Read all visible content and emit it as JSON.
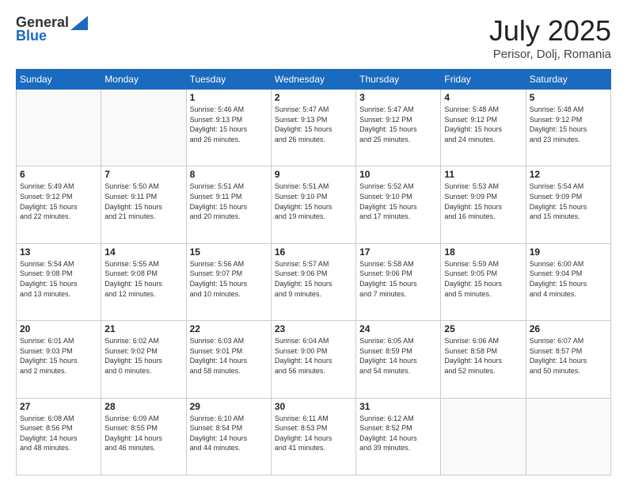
{
  "header": {
    "logo_general": "General",
    "logo_blue": "Blue",
    "month": "July 2025",
    "location": "Perisor, Dolj, Romania"
  },
  "days_of_week": [
    "Sunday",
    "Monday",
    "Tuesday",
    "Wednesday",
    "Thursday",
    "Friday",
    "Saturday"
  ],
  "weeks": [
    [
      {
        "num": "",
        "info": ""
      },
      {
        "num": "",
        "info": ""
      },
      {
        "num": "1",
        "info": "Sunrise: 5:46 AM\nSunset: 9:13 PM\nDaylight: 15 hours\nand 26 minutes."
      },
      {
        "num": "2",
        "info": "Sunrise: 5:47 AM\nSunset: 9:13 PM\nDaylight: 15 hours\nand 26 minutes."
      },
      {
        "num": "3",
        "info": "Sunrise: 5:47 AM\nSunset: 9:12 PM\nDaylight: 15 hours\nand 25 minutes."
      },
      {
        "num": "4",
        "info": "Sunrise: 5:48 AM\nSunset: 9:12 PM\nDaylight: 15 hours\nand 24 minutes."
      },
      {
        "num": "5",
        "info": "Sunrise: 5:48 AM\nSunset: 9:12 PM\nDaylight: 15 hours\nand 23 minutes."
      }
    ],
    [
      {
        "num": "6",
        "info": "Sunrise: 5:49 AM\nSunset: 9:12 PM\nDaylight: 15 hours\nand 22 minutes."
      },
      {
        "num": "7",
        "info": "Sunrise: 5:50 AM\nSunset: 9:11 PM\nDaylight: 15 hours\nand 21 minutes."
      },
      {
        "num": "8",
        "info": "Sunrise: 5:51 AM\nSunset: 9:11 PM\nDaylight: 15 hours\nand 20 minutes."
      },
      {
        "num": "9",
        "info": "Sunrise: 5:51 AM\nSunset: 9:10 PM\nDaylight: 15 hours\nand 19 minutes."
      },
      {
        "num": "10",
        "info": "Sunrise: 5:52 AM\nSunset: 9:10 PM\nDaylight: 15 hours\nand 17 minutes."
      },
      {
        "num": "11",
        "info": "Sunrise: 5:53 AM\nSunset: 9:09 PM\nDaylight: 15 hours\nand 16 minutes."
      },
      {
        "num": "12",
        "info": "Sunrise: 5:54 AM\nSunset: 9:09 PM\nDaylight: 15 hours\nand 15 minutes."
      }
    ],
    [
      {
        "num": "13",
        "info": "Sunrise: 5:54 AM\nSunset: 9:08 PM\nDaylight: 15 hours\nand 13 minutes."
      },
      {
        "num": "14",
        "info": "Sunrise: 5:55 AM\nSunset: 9:08 PM\nDaylight: 15 hours\nand 12 minutes."
      },
      {
        "num": "15",
        "info": "Sunrise: 5:56 AM\nSunset: 9:07 PM\nDaylight: 15 hours\nand 10 minutes."
      },
      {
        "num": "16",
        "info": "Sunrise: 5:57 AM\nSunset: 9:06 PM\nDaylight: 15 hours\nand 9 minutes."
      },
      {
        "num": "17",
        "info": "Sunrise: 5:58 AM\nSunset: 9:06 PM\nDaylight: 15 hours\nand 7 minutes."
      },
      {
        "num": "18",
        "info": "Sunrise: 5:59 AM\nSunset: 9:05 PM\nDaylight: 15 hours\nand 5 minutes."
      },
      {
        "num": "19",
        "info": "Sunrise: 6:00 AM\nSunset: 9:04 PM\nDaylight: 15 hours\nand 4 minutes."
      }
    ],
    [
      {
        "num": "20",
        "info": "Sunrise: 6:01 AM\nSunset: 9:03 PM\nDaylight: 15 hours\nand 2 minutes."
      },
      {
        "num": "21",
        "info": "Sunrise: 6:02 AM\nSunset: 9:02 PM\nDaylight: 15 hours\nand 0 minutes."
      },
      {
        "num": "22",
        "info": "Sunrise: 6:03 AM\nSunset: 9:01 PM\nDaylight: 14 hours\nand 58 minutes."
      },
      {
        "num": "23",
        "info": "Sunrise: 6:04 AM\nSunset: 9:00 PM\nDaylight: 14 hours\nand 56 minutes."
      },
      {
        "num": "24",
        "info": "Sunrise: 6:05 AM\nSunset: 8:59 PM\nDaylight: 14 hours\nand 54 minutes."
      },
      {
        "num": "25",
        "info": "Sunrise: 6:06 AM\nSunset: 8:58 PM\nDaylight: 14 hours\nand 52 minutes."
      },
      {
        "num": "26",
        "info": "Sunrise: 6:07 AM\nSunset: 8:57 PM\nDaylight: 14 hours\nand 50 minutes."
      }
    ],
    [
      {
        "num": "27",
        "info": "Sunrise: 6:08 AM\nSunset: 8:56 PM\nDaylight: 14 hours\nand 48 minutes."
      },
      {
        "num": "28",
        "info": "Sunrise: 6:09 AM\nSunset: 8:55 PM\nDaylight: 14 hours\nand 46 minutes."
      },
      {
        "num": "29",
        "info": "Sunrise: 6:10 AM\nSunset: 8:54 PM\nDaylight: 14 hours\nand 44 minutes."
      },
      {
        "num": "30",
        "info": "Sunrise: 6:11 AM\nSunset: 8:53 PM\nDaylight: 14 hours\nand 41 minutes."
      },
      {
        "num": "31",
        "info": "Sunrise: 6:12 AM\nSunset: 8:52 PM\nDaylight: 14 hours\nand 39 minutes."
      },
      {
        "num": "",
        "info": ""
      },
      {
        "num": "",
        "info": ""
      }
    ]
  ]
}
